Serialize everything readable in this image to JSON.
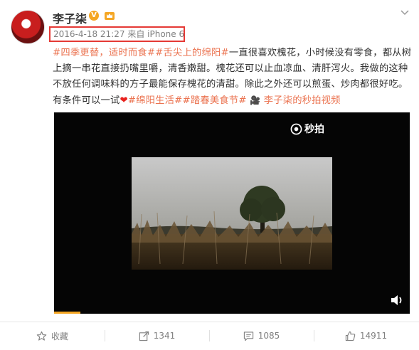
{
  "user": {
    "name": "李子柒",
    "verified_badge": "V"
  },
  "post": {
    "timestamp": "2016-4-18 21:27",
    "source": "来自 iPhone 6",
    "segments": [
      {
        "text": "#四季更替，适时而食#",
        "type": "tag"
      },
      {
        "text": "#舌尖上的绵阳#",
        "type": "tag"
      },
      {
        "text": "一直很喜欢槐花，小时候没有零食，都从树上摘一串花直接扔嘴里嚼，清香嫩甜。槐花还可以止血凉血、清肝泻火。我做的这种不放任何调味料的方子最能保存槐花的清甜。除此之外还可以煎蛋、炒肉都很好吃。有条件可以一试",
        "type": "text"
      },
      {
        "text": "❤",
        "type": "heart"
      },
      {
        "text": "#绵阳生活#",
        "type": "tag"
      },
      {
        "text": "#踏春美食节#",
        "type": "tag"
      },
      {
        "text": "李子柒的秒拍视频",
        "type": "video_link"
      }
    ]
  },
  "video": {
    "watermark": "秒拍",
    "progress": 0.074
  },
  "actions": [
    {
      "label": "收藏",
      "icon": "star-icon"
    },
    {
      "label": "1341",
      "icon": "share-icon"
    },
    {
      "label": "1085",
      "icon": "comment-icon"
    },
    {
      "label": "14911",
      "icon": "like-icon"
    }
  ],
  "colors": {
    "accent": "#eb7350",
    "highlight_box": "#e53935",
    "badge": "#f5a623"
  }
}
